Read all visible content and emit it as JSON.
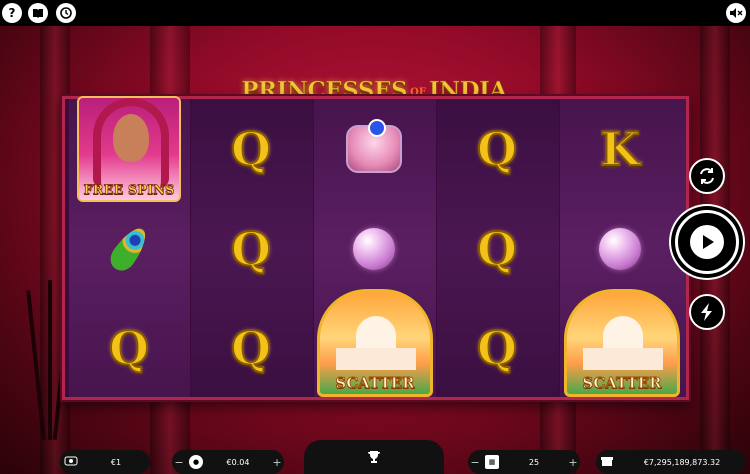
{
  "top_bar": {
    "help_icon": "question-icon",
    "paytable_icon": "book-icon",
    "history_icon": "history-clock-icon",
    "sound_icon": "speaker-muted-icon"
  },
  "game": {
    "title_main_left": "PRINCESSES",
    "title_of": "OF",
    "title_main_right": "INDIA"
  },
  "reels": [
    [
      "princess-free-spins",
      "peacock-feather",
      "Q"
    ],
    [
      "Q",
      "Q",
      "Q"
    ],
    [
      "jewel-box",
      "pink-pearl",
      "taj-mahal-scatter"
    ],
    [
      "Q",
      "Q",
      "Q"
    ],
    [
      "K",
      "pink-pearl",
      "taj-mahal-scatter"
    ]
  ],
  "symbol_labels": {
    "free_spins": "FREE SPINS",
    "scatter": "SCATTER",
    "letter_q": "Q",
    "letter_k": "K"
  },
  "controls": {
    "autoplay_icon": "refresh-cycle-icon",
    "spin_icon": "play-icon",
    "turbo_icon": "lightning-icon"
  },
  "bottom_bar": {
    "balance_icon": "money-icon",
    "balance_value": "€1",
    "bet_minus": "−",
    "bet_value": "€0.04",
    "bet_plus": "+",
    "trophy_icon": "trophy-icon",
    "lines_minus": "−",
    "lines_value": "25",
    "lines_plus": "+",
    "jackpot_icon": "gift-icon",
    "jackpot_value": "€7,295,189,873.32"
  },
  "colors": {
    "background": "#8e0a26",
    "reel_frame": "#b0264c",
    "reel_bg": "#47144d",
    "letter_gold": "#f3c21a"
  }
}
